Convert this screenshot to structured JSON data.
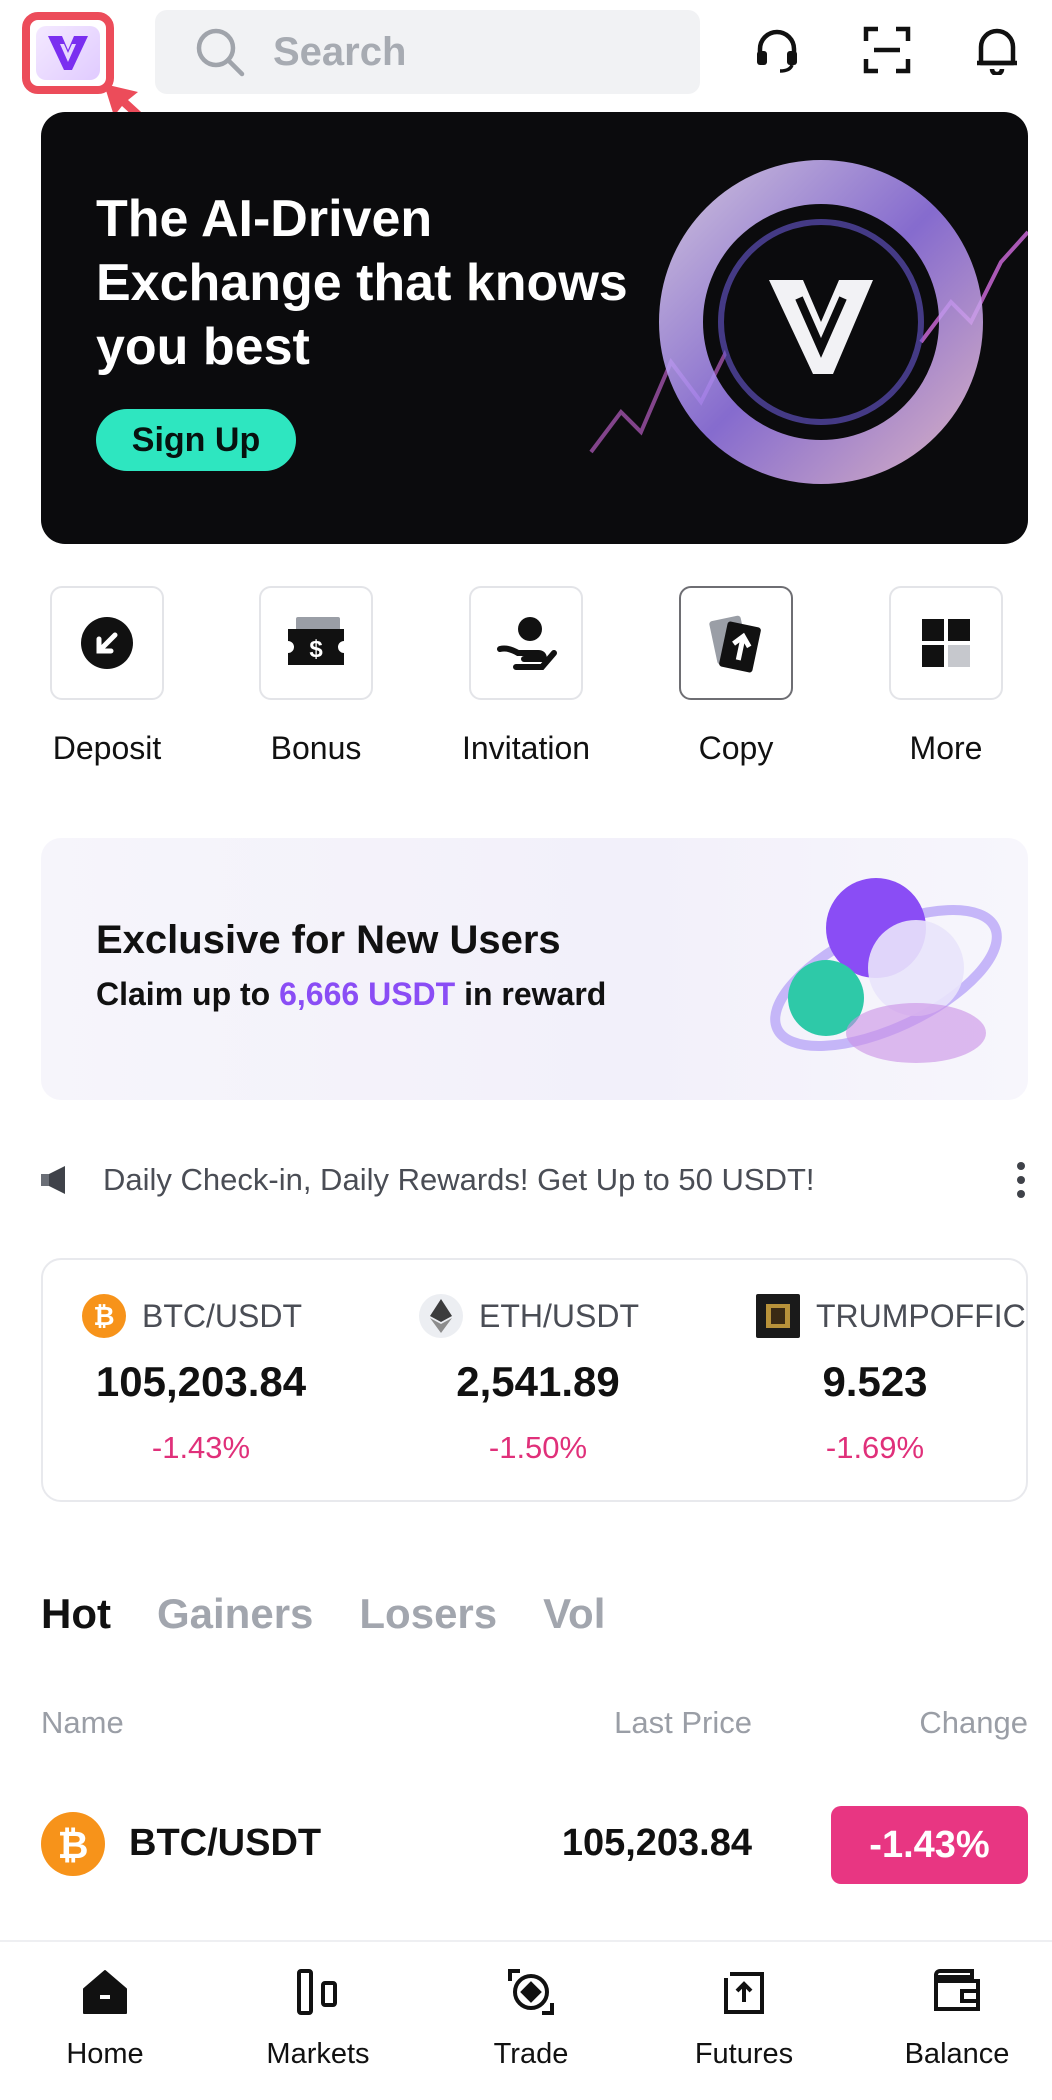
{
  "header": {
    "search_placeholder": "Search",
    "icons": [
      "headset-icon",
      "scan-icon",
      "bell-icon"
    ]
  },
  "hero": {
    "title": "The AI-Driven Exchange that knows you best",
    "cta": "Sign Up"
  },
  "quick_actions": [
    {
      "label": "Deposit",
      "icon": "deposit-icon"
    },
    {
      "label": "Bonus",
      "icon": "bonus-ticket-icon"
    },
    {
      "label": "Invitation",
      "icon": "invitation-icon"
    },
    {
      "label": "Copy",
      "icon": "copy-trade-icon"
    },
    {
      "label": "More",
      "icon": "more-grid-icon"
    }
  ],
  "promo": {
    "title": "Exclusive for New Users",
    "sub_prefix": "Claim up to ",
    "sub_highlight": "6,666 USDT",
    "sub_suffix": " in reward"
  },
  "announcement": {
    "text": "Daily Check-in, Daily Rewards! Get Up to 50 USDT!"
  },
  "tickers": [
    {
      "pair": "BTC/USDT",
      "price": "105,203.84",
      "change": "-1.43%"
    },
    {
      "pair": "ETH/USDT",
      "price": "2,541.89",
      "change": "-1.50%"
    },
    {
      "pair": "TRUMPOFFIC",
      "price": "9.523",
      "change": "-1.69%"
    }
  ],
  "market": {
    "tabs": [
      "Hot",
      "Gainers",
      "Losers",
      "Vol"
    ],
    "active_tab": "Hot",
    "columns": {
      "name": "Name",
      "last_price": "Last Price",
      "change": "Change"
    },
    "rows": [
      {
        "pair": "BTC/USDT",
        "last_price": "105,203.84",
        "change": "-1.43%"
      }
    ]
  },
  "bottom_nav": [
    {
      "label": "Home",
      "icon": "home-icon",
      "active": true
    },
    {
      "label": "Markets",
      "icon": "markets-icon"
    },
    {
      "label": "Trade",
      "icon": "trade-icon"
    },
    {
      "label": "Futures",
      "icon": "futures-icon"
    },
    {
      "label": "Balance",
      "icon": "wallet-icon"
    }
  ],
  "colors": {
    "accent_teal": "#2ee6c0",
    "accent_purple": "#8a4df5",
    "negative": "#e0307a",
    "highlight_box": "#ec4c5a"
  }
}
